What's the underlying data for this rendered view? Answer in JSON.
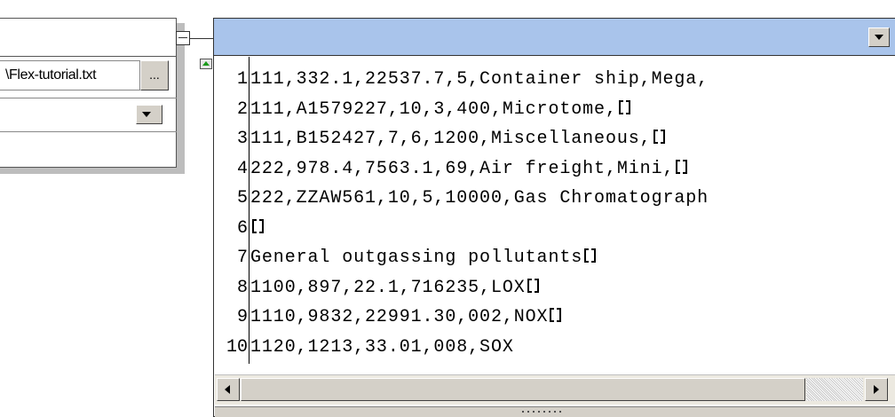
{
  "left_component": {
    "file_name": "\\Flex-tutorial.txt",
    "browse_label": "..."
  },
  "text_component": {
    "lines": [
      {
        "num": "1",
        "text": "111,332.1,22537.7,5,Container ship,Mega,",
        "newline": false
      },
      {
        "num": "2",
        "text": "111,A1579227,10,3,400,Microtome,",
        "newline": true
      },
      {
        "num": "3",
        "text": "111,B152427,7,6,1200,Miscellaneous,",
        "newline": true
      },
      {
        "num": "4",
        "text": "222,978.4,7563.1,69,Air freight,Mini,",
        "newline": true
      },
      {
        "num": "5",
        "text": "222,ZZAW561,10,5,10000,Gas Chromatograph",
        "newline": false
      },
      {
        "num": "6",
        "text": "",
        "newline": true
      },
      {
        "num": "7",
        "text": "General outgassing pollutants",
        "newline": true
      },
      {
        "num": "8",
        "text": "1100,897,22.1,716235,LOX",
        "newline": true
      },
      {
        "num": "9",
        "text": "1110,9832,22991.30,002,NOX",
        "newline": true
      },
      {
        "num": "10",
        "text": "1120,1213,33.01,008,SOX",
        "newline": false
      }
    ]
  },
  "colors": {
    "title_bar": "#a9c4eb",
    "button_face": "#d4d0c8",
    "arrow_green": "#1a9a1a"
  },
  "icons": {
    "newline_marker": "line-break-icon",
    "dropdown": "chevron-down-icon",
    "collapse": "collapse-icon"
  }
}
